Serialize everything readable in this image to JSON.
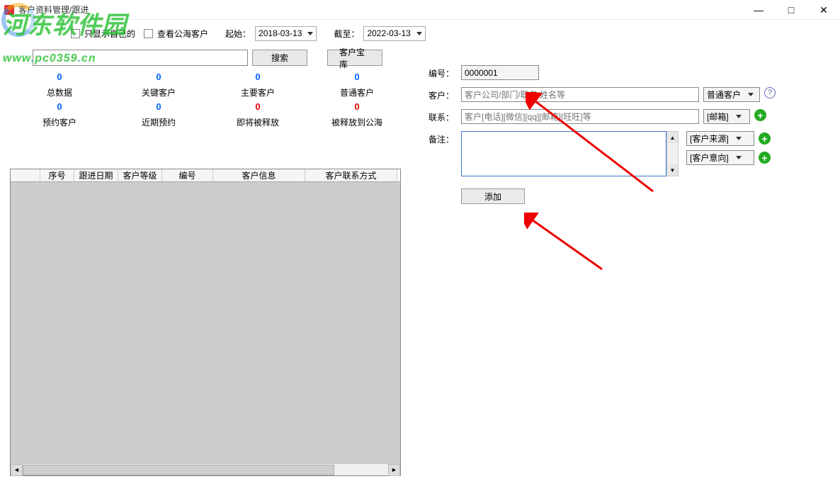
{
  "window": {
    "title": "客户资料管理/跟进",
    "min": "—",
    "max": "□",
    "close": "✕"
  },
  "watermark": {
    "text_a": "河东软件园",
    "text_b": "www",
    "text_c": "pc0359",
    "text_d": "cn"
  },
  "filter": {
    "only_mine": "只显示自己的",
    "view_public": "查看公海客户",
    "start_lbl": "起始：",
    "start_val": "2018-03-13",
    "end_lbl": "截至：",
    "end_val": "2022-03-13",
    "search_btn": "搜索",
    "treasure_btn": "客户宝库"
  },
  "stats": [
    {
      "num": "0",
      "label": "总数据",
      "red": false
    },
    {
      "num": "0",
      "label": "关键客户",
      "red": false
    },
    {
      "num": "0",
      "label": "主要客户",
      "red": false
    },
    {
      "num": "0",
      "label": "普通客户",
      "red": false
    },
    {
      "num": "0",
      "label": "预约客户",
      "red": false
    },
    {
      "num": "0",
      "label": "近期预约",
      "red": false
    },
    {
      "num": "0",
      "label": "即将被释放",
      "red": true
    },
    {
      "num": "0",
      "label": "被释放到公海",
      "red": true
    }
  ],
  "grid": {
    "cols": [
      "",
      "序号",
      "跟进日期",
      "客户等级",
      "编号",
      "客户信息",
      "客户联系方式"
    ]
  },
  "form": {
    "no_lbl": "编号：",
    "no_val": "0000001",
    "cust_lbl": "客户：",
    "cust_ph": "客户公司/部门/职务/姓名等",
    "cust_type": "普通客户",
    "contact_lbl": "联系：",
    "contact_ph": "客户[电话][微信][qq][邮箱][旺旺]等",
    "contact_type": "[邮箱]",
    "remark_lbl": "备注：",
    "source_sel": "[客户来源]",
    "intent_sel": "[客户意向]",
    "add_btn": "添加"
  }
}
